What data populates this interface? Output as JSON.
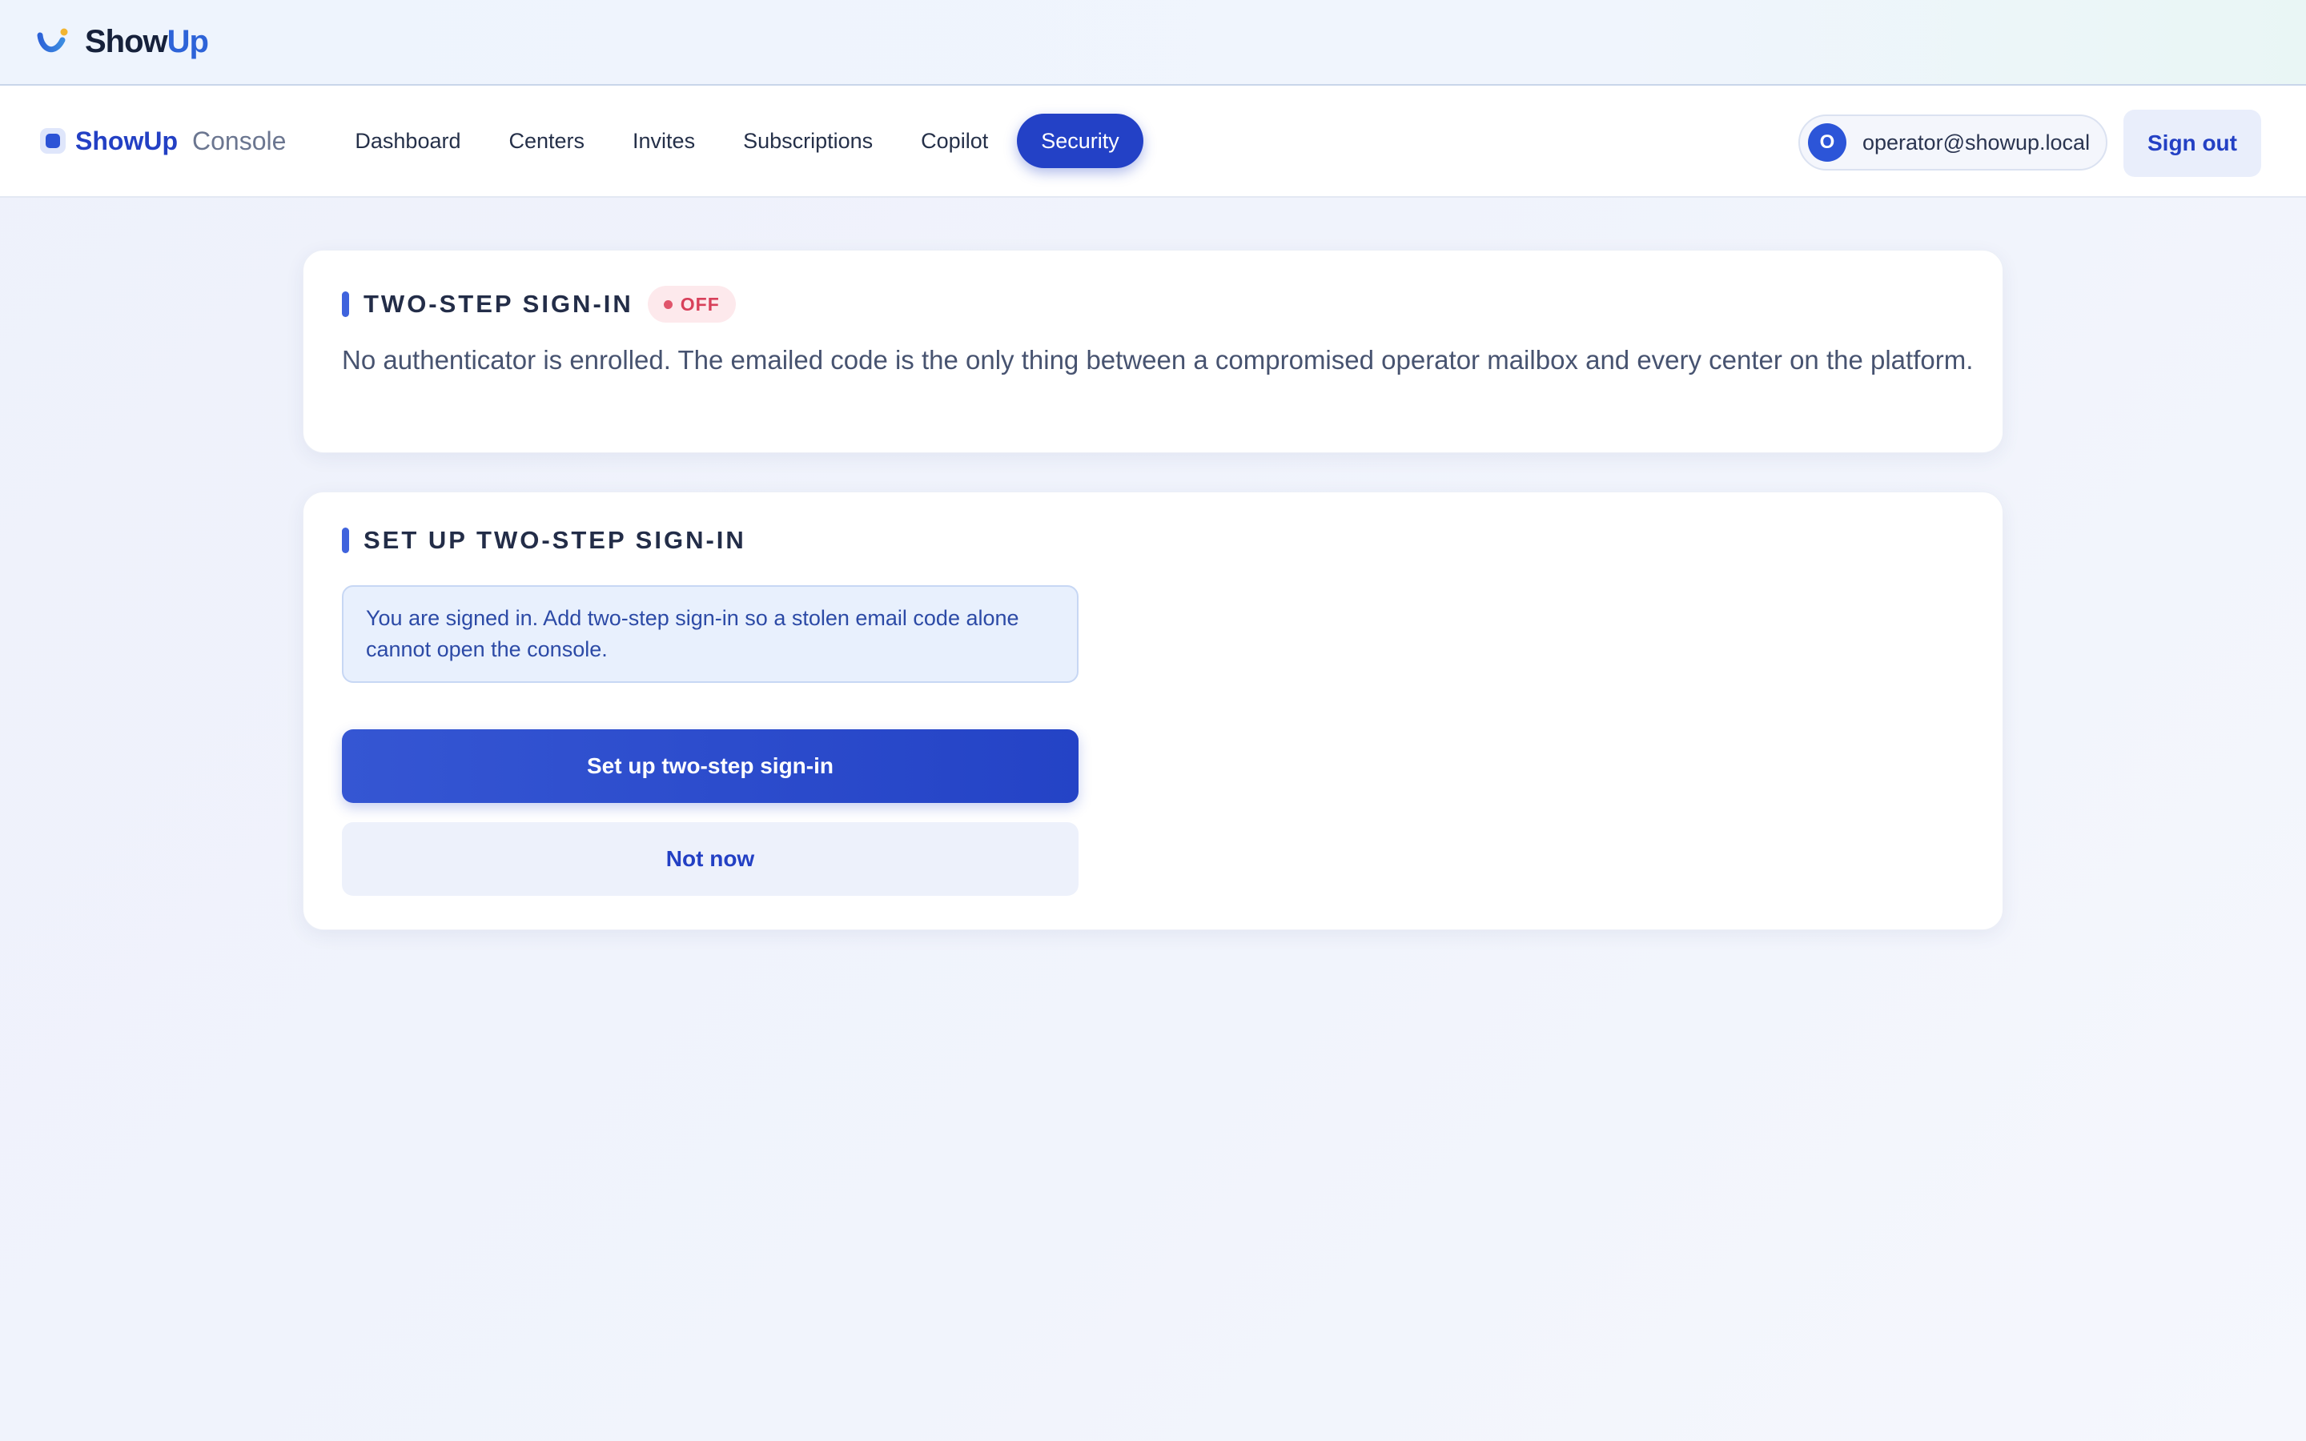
{
  "brand": {
    "name_main": "Show",
    "name_accent": "Up",
    "logo_icon": "checkmark-swoosh-icon"
  },
  "nav": {
    "console_name": "ShowUp",
    "console_sub": "Console",
    "links": [
      {
        "label": "Dashboard",
        "active": false
      },
      {
        "label": "Centers",
        "active": false
      },
      {
        "label": "Invites",
        "active": false
      },
      {
        "label": "Subscriptions",
        "active": false
      },
      {
        "label": "Copilot",
        "active": false
      },
      {
        "label": "Security",
        "active": true
      }
    ],
    "user": {
      "avatar_initial": "O",
      "email": "operator@showup.local"
    },
    "signout_label": "Sign out"
  },
  "status_card": {
    "title": "TWO-STEP SIGN-IN",
    "badge": "OFF",
    "description": "No authenticator is enrolled. The emailed code is the only thing between a compromised operator mailbox and every center on the platform."
  },
  "setup_card": {
    "title": "SET UP TWO-STEP SIGN-IN",
    "info": "You are signed in. Add two-step sign-in so a stolen email code alone cannot open the console.",
    "primary_button": "Set up two-step sign-in",
    "secondary_button": "Not now"
  },
  "colors": {
    "accent": "#2341c6",
    "brand_accent": "#2d63d8",
    "danger": "#d8405a",
    "info_bg": "#e8f0fd"
  }
}
